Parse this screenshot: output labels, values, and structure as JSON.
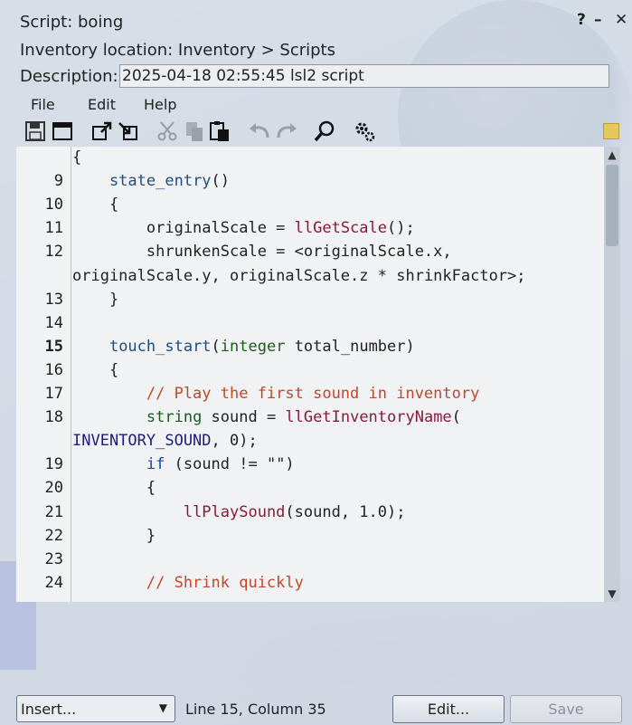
{
  "window": {
    "title": "Script: boing",
    "help_glyph": "?",
    "minimize_glyph": "–",
    "close_glyph": "✕"
  },
  "inventory_location": "Inventory location: Inventory > Scripts",
  "description": {
    "label": "Description:",
    "value": "2025-04-18 02:55:45 lsl2 script"
  },
  "menu": [
    "File",
    "Edit",
    "Help"
  ],
  "toolbar_icons": [
    {
      "name": "save-icon",
      "enabled": true
    },
    {
      "name": "window-icon",
      "enabled": true
    },
    {
      "name": "export-icon",
      "enabled": true
    },
    {
      "name": "import-icon",
      "enabled": true
    },
    {
      "name": "cut-icon",
      "enabled": false
    },
    {
      "name": "copy-icon",
      "enabled": false
    },
    {
      "name": "paste-icon",
      "enabled": true
    },
    {
      "name": "undo-icon",
      "enabled": false
    },
    {
      "name": "redo-icon",
      "enabled": false
    },
    {
      "name": "search-icon",
      "enabled": true
    },
    {
      "name": "settings-icon",
      "enabled": true
    }
  ],
  "editor": {
    "current_line": "15",
    "lines": [
      {
        "n": "",
        "t": "{"
      },
      {
        "n": "9",
        "t": "    state_entry()"
      },
      {
        "n": "10",
        "t": "    {"
      },
      {
        "n": "11",
        "t": "        originalScale = llGetScale();"
      },
      {
        "n": "12",
        "t": "        shrunkenScale = <originalScale.x,"
      },
      {
        "n": "",
        "t": "originalScale.y, originalScale.z * shrinkFactor>;"
      },
      {
        "n": "13",
        "t": "    }"
      },
      {
        "n": "14",
        "t": ""
      },
      {
        "n": "15",
        "t": "    touch_start(integer total_number)"
      },
      {
        "n": "16",
        "t": "    {"
      },
      {
        "n": "17",
        "t": "        // Play the first sound in inventory"
      },
      {
        "n": "18",
        "t": "        string sound = llGetInventoryName("
      },
      {
        "n": "",
        "t": "INVENTORY_SOUND, 0);"
      },
      {
        "n": "19",
        "t": "        if (sound != \"\")"
      },
      {
        "n": "20",
        "t": "        {"
      },
      {
        "n": "21",
        "t": "            llPlaySound(sound, 1.0);"
      },
      {
        "n": "22",
        "t": "        }"
      },
      {
        "n": "23",
        "t": ""
      },
      {
        "n": "24",
        "t": "        // Shrink quickly"
      }
    ]
  },
  "bottom": {
    "insert_label": "Insert...",
    "status": "Line 15, Column 35",
    "edit_button": "Edit...",
    "save_button": "Save"
  },
  "colors": {
    "comment": "#c3472a",
    "function": "#1d4e86",
    "ll_function": "#8a1a3c",
    "type": "#1f5b1f",
    "constant": "#1e1e7c"
  }
}
